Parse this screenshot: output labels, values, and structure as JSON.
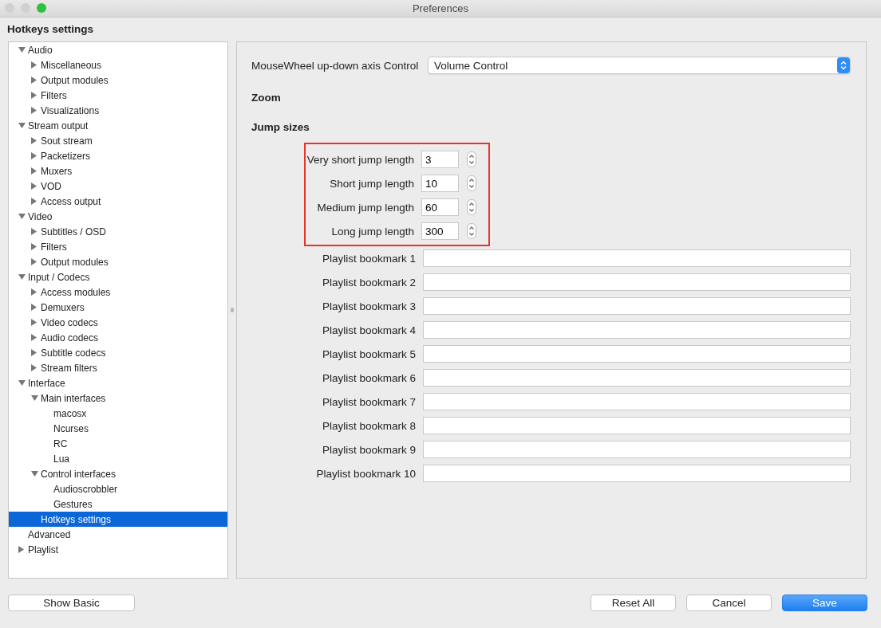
{
  "window": {
    "title": "Preferences"
  },
  "heading": "Hotkeys settings",
  "tree": [
    {
      "label": "Audio",
      "expanded": true,
      "selected": false,
      "children": [
        {
          "label": "Miscellaneous",
          "expanded": false,
          "selected": false
        },
        {
          "label": "Output modules",
          "expanded": false,
          "selected": false
        },
        {
          "label": "Filters",
          "expanded": false,
          "selected": false
        },
        {
          "label": "Visualizations",
          "expanded": false,
          "selected": false
        }
      ]
    },
    {
      "label": "Stream output",
      "expanded": true,
      "selected": false,
      "children": [
        {
          "label": "Sout stream",
          "expanded": false,
          "selected": false
        },
        {
          "label": "Packetizers",
          "expanded": false,
          "selected": false
        },
        {
          "label": "Muxers",
          "expanded": false,
          "selected": false
        },
        {
          "label": "VOD",
          "expanded": false,
          "selected": false
        },
        {
          "label": "Access output",
          "expanded": false,
          "selected": false
        }
      ]
    },
    {
      "label": "Video",
      "expanded": true,
      "selected": false,
      "children": [
        {
          "label": "Subtitles / OSD",
          "expanded": false,
          "selected": false
        },
        {
          "label": "Filters",
          "expanded": false,
          "selected": false
        },
        {
          "label": "Output modules",
          "expanded": false,
          "selected": false
        }
      ]
    },
    {
      "label": "Input / Codecs",
      "expanded": true,
      "selected": false,
      "children": [
        {
          "label": "Access modules",
          "expanded": false,
          "selected": false
        },
        {
          "label": "Demuxers",
          "expanded": false,
          "selected": false
        },
        {
          "label": "Video codecs",
          "expanded": false,
          "selected": false
        },
        {
          "label": "Audio codecs",
          "expanded": false,
          "selected": false
        },
        {
          "label": "Subtitle codecs",
          "expanded": false,
          "selected": false
        },
        {
          "label": "Stream filters",
          "expanded": false,
          "selected": false
        }
      ]
    },
    {
      "label": "Interface",
      "expanded": true,
      "selected": false,
      "children": [
        {
          "label": "Main interfaces",
          "expanded": true,
          "selected": false,
          "children": [
            {
              "label": "macosx",
              "selected": false
            },
            {
              "label": "Ncurses",
              "selected": false
            },
            {
              "label": "RC",
              "selected": false
            },
            {
              "label": "Lua",
              "selected": false
            }
          ]
        },
        {
          "label": "Control interfaces",
          "expanded": true,
          "selected": false,
          "children": [
            {
              "label": "Audioscrobbler",
              "selected": false
            },
            {
              "label": "Gestures",
              "selected": false
            }
          ]
        },
        {
          "label": "Hotkeys settings",
          "selected": true
        }
      ]
    },
    {
      "label": "Advanced",
      "selected": false
    },
    {
      "label": "Playlist",
      "expanded": false,
      "selected": false
    }
  ],
  "mousewheel": {
    "label": "MouseWheel up-down axis Control",
    "value": "Volume Control"
  },
  "sections": [
    "Zoom",
    "Jump sizes"
  ],
  "jump_sizes": {
    "highlighted": true,
    "fields": [
      {
        "label": "Very short jump length",
        "value": "3"
      },
      {
        "label": "Short jump length",
        "value": "10"
      },
      {
        "label": "Medium jump length",
        "value": "60"
      },
      {
        "label": "Long jump length",
        "value": "300"
      }
    ]
  },
  "bookmarks": [
    {
      "label": "Playlist bookmark 1"
    },
    {
      "label": "Playlist bookmark 2"
    },
    {
      "label": "Playlist bookmark 3"
    },
    {
      "label": "Playlist bookmark 4"
    },
    {
      "label": "Playlist bookmark 5"
    },
    {
      "label": "Playlist bookmark 6"
    },
    {
      "label": "Playlist bookmark 7"
    },
    {
      "label": "Playlist bookmark 8"
    },
    {
      "label": "Playlist bookmark 9"
    },
    {
      "label": "Playlist bookmark 10"
    }
  ],
  "buttons": [
    {
      "label": "Show Basic",
      "default": false
    },
    {
      "label": "Reset All",
      "default": false
    },
    {
      "label": "Cancel",
      "default": false
    },
    {
      "label": "Save",
      "default": true
    }
  ]
}
